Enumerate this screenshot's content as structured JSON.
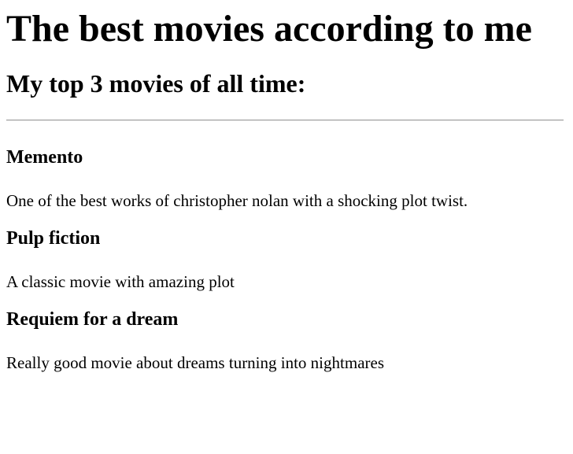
{
  "page": {
    "title": "The best movies according to me",
    "subtitle": "My top 3 movies of all time:"
  },
  "movies": [
    {
      "title": "Memento",
      "description": "One of the best works of christopher nolan with a shocking plot twist."
    },
    {
      "title": "Pulp fiction",
      "description": "A classic movie with amazing plot"
    },
    {
      "title": "Requiem for a dream",
      "description": "Really good movie about dreams turning into nightmares"
    }
  ]
}
